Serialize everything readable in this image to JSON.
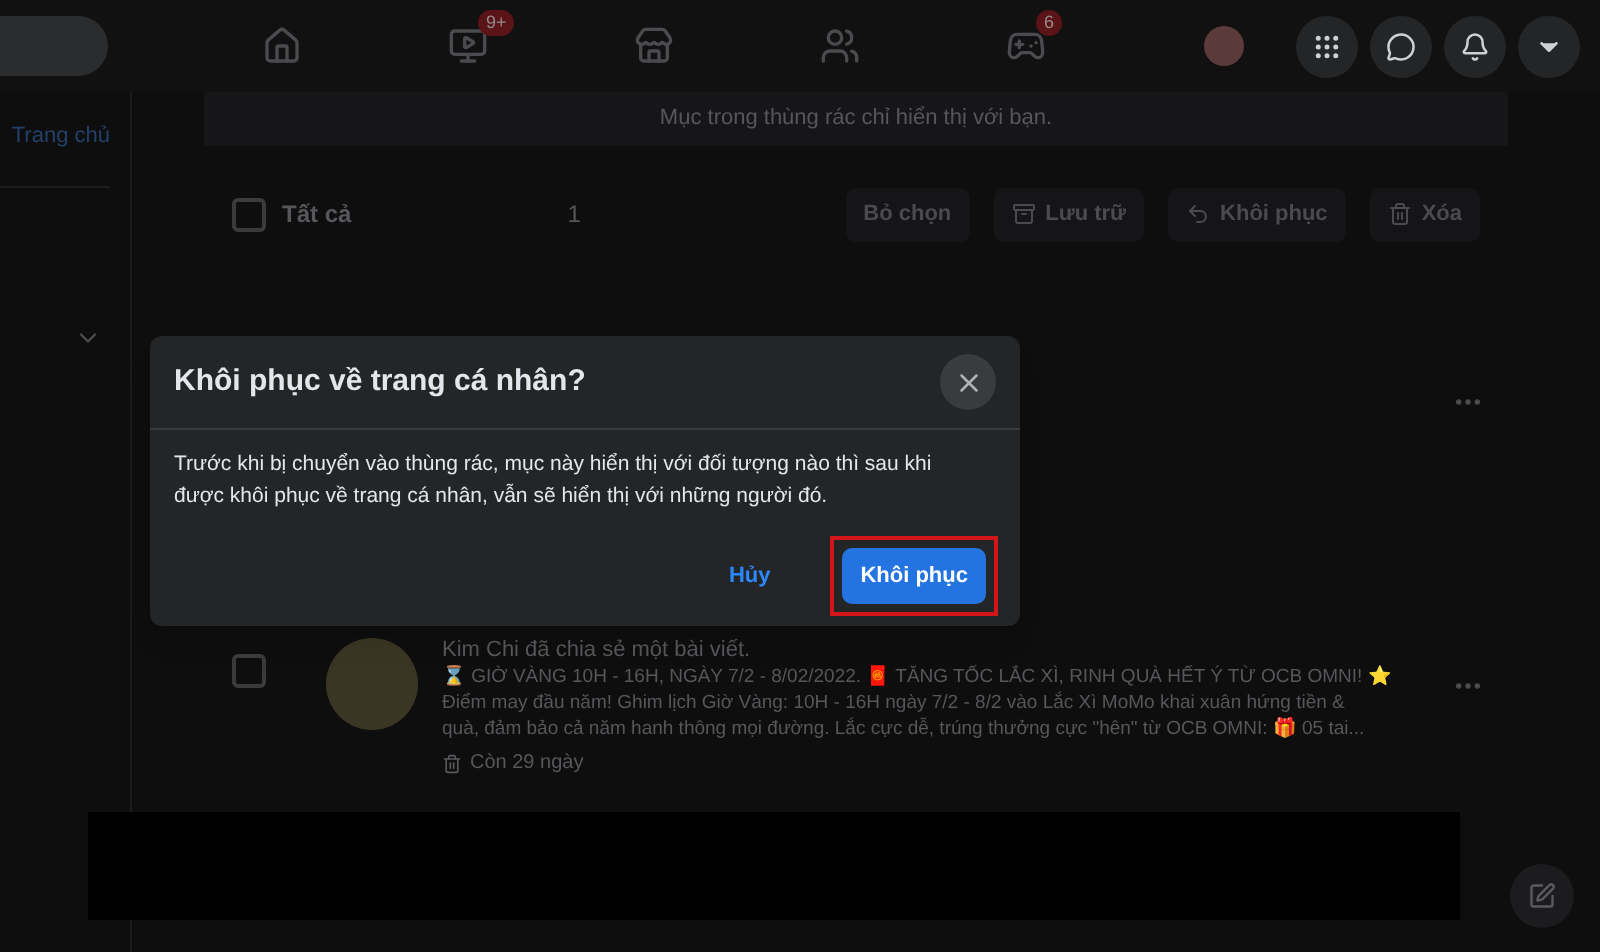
{
  "nav_badges": [
    "9+",
    "6"
  ],
  "sidebar": {
    "link": "Trang chủ"
  },
  "trash": {
    "notice": "Mục trong thùng rác chỉ hiển thị với bạn.",
    "select_all": {
      "label": "Tất cả",
      "checked": false
    },
    "count": "1",
    "actions": [
      "Bỏ chọn",
      "Lưu trữ",
      "Khôi phục",
      "Xóa"
    ]
  },
  "post": {
    "checked": false,
    "title": "Kim Chi đã chia sẻ một bài viết.",
    "lines": [
      "⌛ GIỜ VÀNG 10H - 16H, NGÀY 7/2 - 8/02/2022. 🧧 TĂNG TỐC LẮC XÌ, RINH QUÀ HẾT Ý TỪ OCB OMNI! ⭐",
      "Điểm may đầu năm! Ghim lịch Giờ Vàng: 10H - 16H ngày 7/2 - 8/2 vào Lắc Xì MoMo khai xuân hứng tiền &",
      "quà, đảm bảo cả năm hanh thông mọi đường. Lắc cực dễ, trúng thưởng cực \"hên\" từ OCB OMNI: 🎁 05 tai..."
    ],
    "remaining": "Còn 29 ngày"
  },
  "dialog": {
    "title": "Khôi phục về trang cá nhân?",
    "body": "Trước khi bị chuyển vào thùng rác, mục này hiển thị với đối tượng nào thì sau khi được khôi phục về trang cá nhân, vẫn sẽ hiển thị với những người đó.",
    "cancel": "Hủy",
    "confirm": "Khôi phục"
  }
}
